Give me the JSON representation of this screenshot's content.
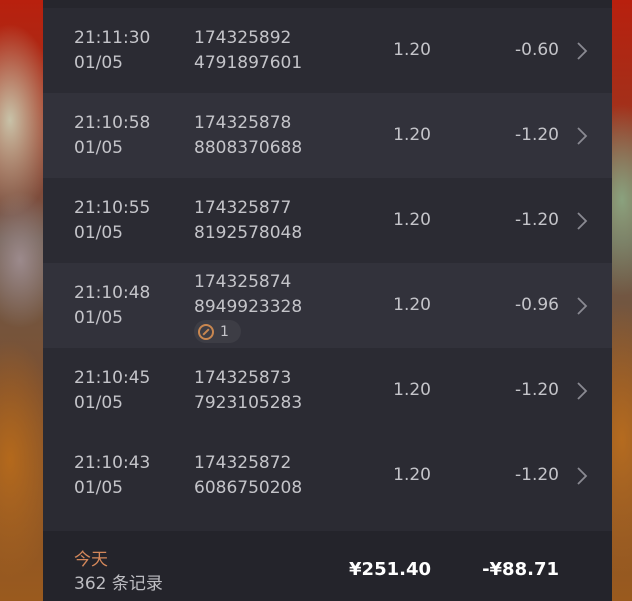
{
  "rows": [
    {
      "time": "21:11:30",
      "date": "01/05",
      "order_line1": "174325892",
      "order_line2": "4791897601",
      "amount": "1.20",
      "refund": "-0.60"
    },
    {
      "time": "21:10:58",
      "date": "01/05",
      "order_line1": "174325878",
      "order_line2": "8808370688",
      "amount": "1.20",
      "refund": "-1.20"
    },
    {
      "time": "21:10:55",
      "date": "01/05",
      "order_line1": "174325877",
      "order_line2": "8192578048",
      "amount": "1.20",
      "refund": "-1.20"
    },
    {
      "time": "21:10:48",
      "date": "01/05",
      "order_line1": "174325874",
      "order_line2": "8949923328",
      "amount": "1.20",
      "refund": "-0.96",
      "badge_icon": "link-icon",
      "badge_count": "1"
    },
    {
      "time": "21:10:45",
      "date": "01/05",
      "order_line1": "174325873",
      "order_line2": "7923105283",
      "amount": "1.20",
      "refund": "-1.20"
    },
    {
      "time": "21:10:43",
      "date": "01/05",
      "order_line1": "174325872",
      "order_line2": "6086750208",
      "amount": "1.20",
      "refund": "-1.20"
    }
  ],
  "footer": {
    "today_label": "今天",
    "count_text": "362 条记录",
    "total_amount": "¥251.40",
    "total_refund": "-¥88.71"
  },
  "colors": {
    "panel": "#2b2b33",
    "accent": "#d4875a",
    "text": "#c4c4c9"
  }
}
